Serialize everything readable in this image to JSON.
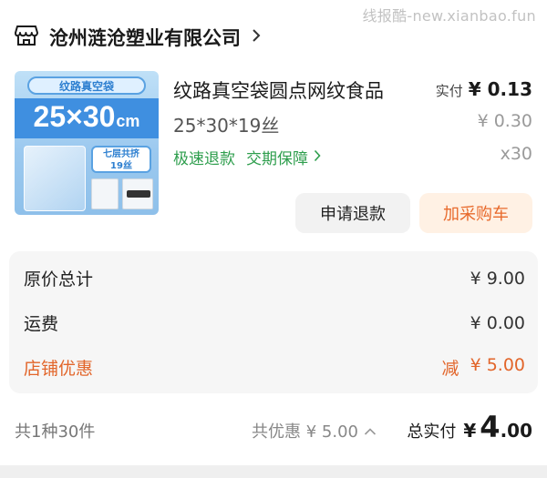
{
  "watermark": "线报酷-new.xianbao.fun",
  "shop": {
    "name": "沧州涟沧塑业有限公司",
    "icon": "store-icon"
  },
  "product": {
    "image": {
      "top_label": "纹路真空袋",
      "size_main": "25×30",
      "size_unit": "cm",
      "badge_line1": "七层共挤",
      "badge_line2": "19丝"
    },
    "title": "纹路真空袋圆点网纹食品",
    "spec": "25*30*19丝",
    "tag_fast_refund": "极速退款",
    "tag_delivery": "交期保障",
    "price_label": "实付",
    "price_now": "¥ 0.13",
    "price_original": "¥ 0.30",
    "quantity": "x30"
  },
  "actions": {
    "refund": "申请退款",
    "add_cart": "加采购车"
  },
  "summary": {
    "original_total_label": "原价总计",
    "original_total_value": "¥ 9.00",
    "shipping_label": "运费",
    "shipping_value": "¥ 0.00",
    "discount_label": "店铺优惠",
    "discount_prefix": "减",
    "discount_value": "¥ 5.00"
  },
  "footer": {
    "count": "共1种30件",
    "saved": "共优惠 ¥ 5.00",
    "total_label": "总实付",
    "total_currency": "¥",
    "total_int": "4",
    "total_dec": ".00"
  },
  "colors": {
    "accent_orange": "#e2652a",
    "tag_green": "#2e9e4d",
    "cart_bg": "#fff1e4"
  }
}
